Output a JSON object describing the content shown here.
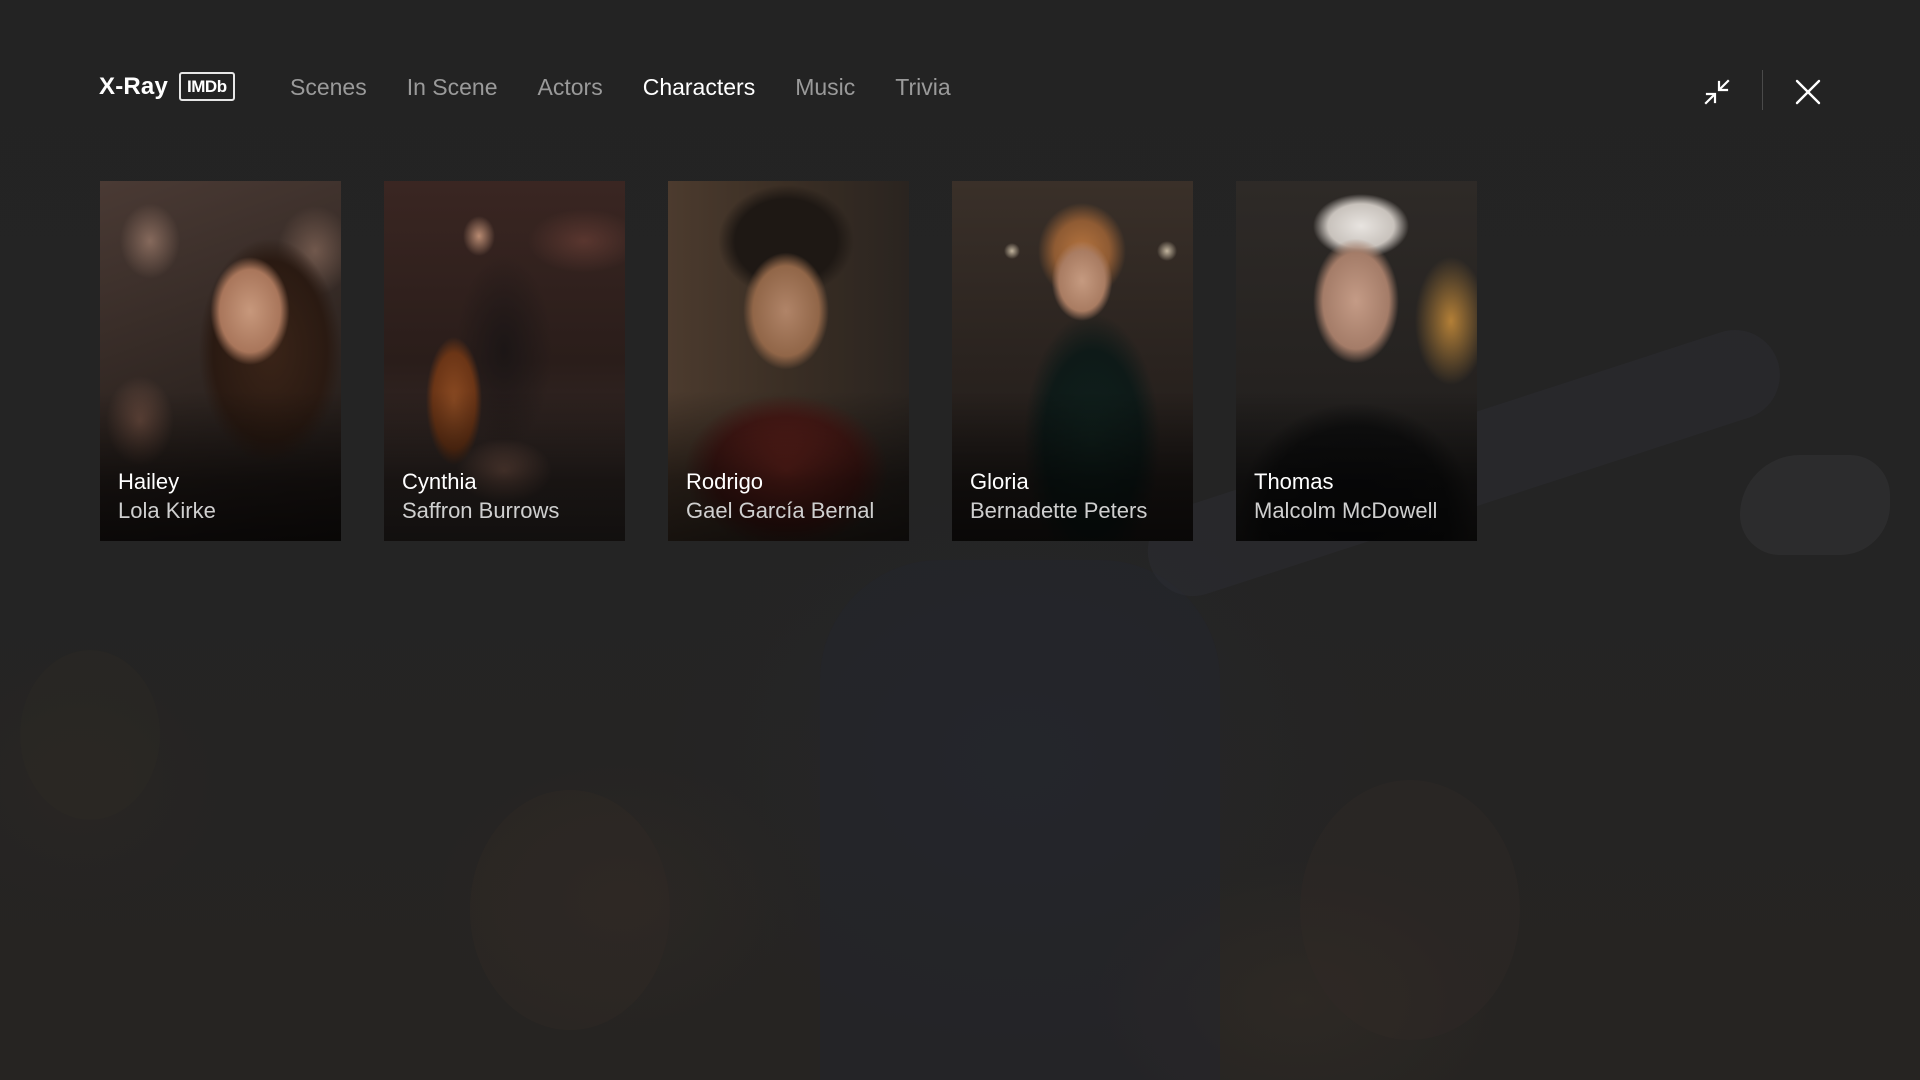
{
  "header": {
    "brand_title": "X-Ray",
    "imdb_badge": "IMDb",
    "tabs": [
      {
        "label": "Scenes",
        "active": false
      },
      {
        "label": "In Scene",
        "active": false
      },
      {
        "label": "Actors",
        "active": false
      },
      {
        "label": "Characters",
        "active": true
      },
      {
        "label": "Music",
        "active": false
      },
      {
        "label": "Trivia",
        "active": false
      }
    ],
    "controls": {
      "minimize_icon": "minimize-arrows-icon",
      "close_icon": "close-icon"
    }
  },
  "characters": [
    {
      "character": "Hailey",
      "actor": "Lola Kirke"
    },
    {
      "character": "Cynthia",
      "actor": "Saffron Burrows"
    },
    {
      "character": "Rodrigo",
      "actor": "Gael García Bernal"
    },
    {
      "character": "Gloria",
      "actor": "Bernadette Peters"
    },
    {
      "character": "Thomas",
      "actor": "Malcolm McDowell"
    }
  ],
  "colors": {
    "background": "#232323",
    "active_tab": "#ffffff",
    "inactive_tab": "#9a9a9a",
    "actor_text": "#cfcfcf"
  }
}
